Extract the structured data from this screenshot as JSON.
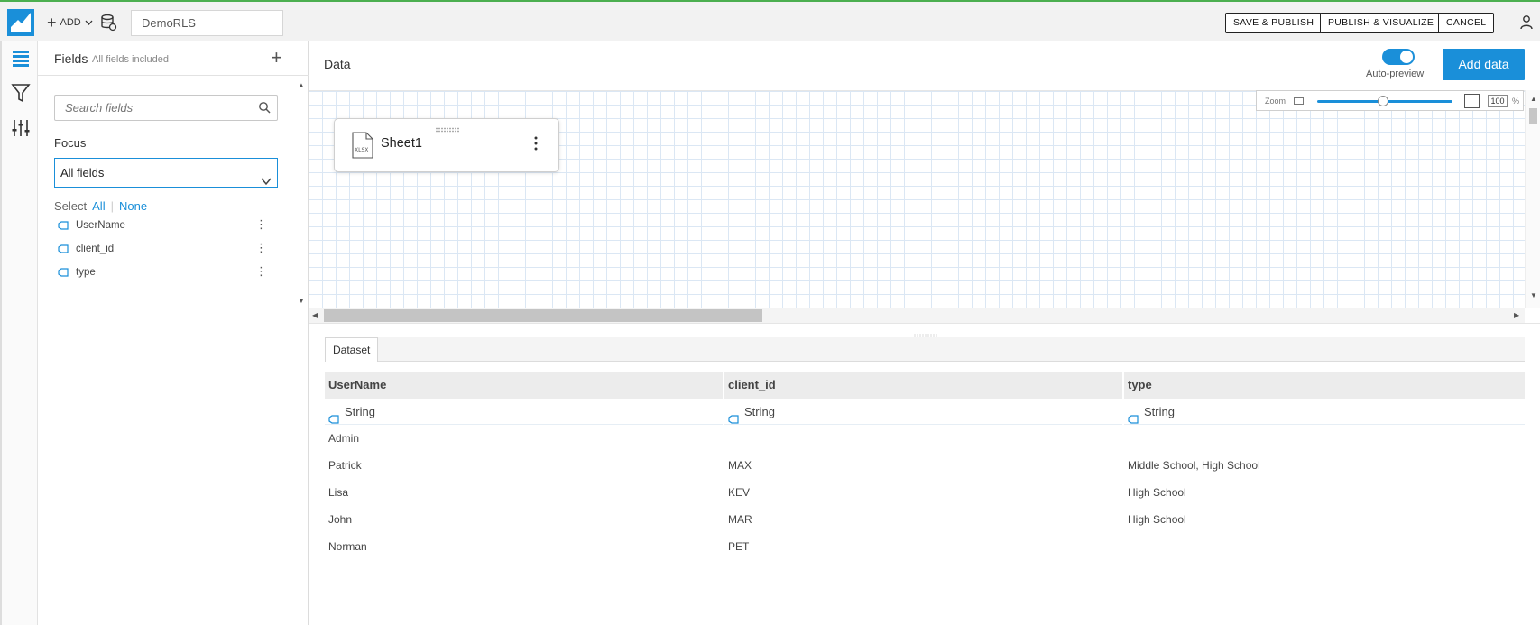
{
  "colors": {
    "accent": "#1a8fd9",
    "topbar_bg": "#f2f2f2",
    "grid": "#dbe7f4"
  },
  "topbar": {
    "add_label": "ADD",
    "dataset_name": "DemoRLS",
    "save_publish": "SAVE & PUBLISH",
    "publish_visualize": "PUBLISH & VISUALIZE",
    "cancel": "CANCEL"
  },
  "fields_panel": {
    "title": "Fields",
    "subtitle": "All fields included",
    "search_placeholder": "Search fields",
    "focus_label": "Focus",
    "focus_value": "All fields",
    "select_label": "Select",
    "select_all": "All",
    "select_none": "None",
    "items": [
      {
        "label": "UserName"
      },
      {
        "label": "client_id"
      },
      {
        "label": "type"
      }
    ]
  },
  "data_area": {
    "title": "Data",
    "auto_preview_label": "Auto-preview",
    "auto_preview_on": true,
    "add_data_label": "Add data",
    "zoom_label": "Zoom",
    "zoom_value": "100",
    "zoom_unit": "%",
    "source": {
      "file_type": "XLSX",
      "name": "Sheet1"
    }
  },
  "dataset_table": {
    "tab_label": "Dataset",
    "columns": [
      {
        "name": "UserName",
        "type": "String"
      },
      {
        "name": "client_id",
        "type": "String"
      },
      {
        "name": "type",
        "type": "String"
      }
    ],
    "rows": [
      [
        "Admin",
        "",
        ""
      ],
      [
        "Patrick",
        "MAX",
        "Middle School, High School"
      ],
      [
        "Lisa",
        "KEV",
        "High School"
      ],
      [
        "John",
        "MAR",
        "High School"
      ],
      [
        "Norman",
        "PET",
        ""
      ]
    ]
  }
}
